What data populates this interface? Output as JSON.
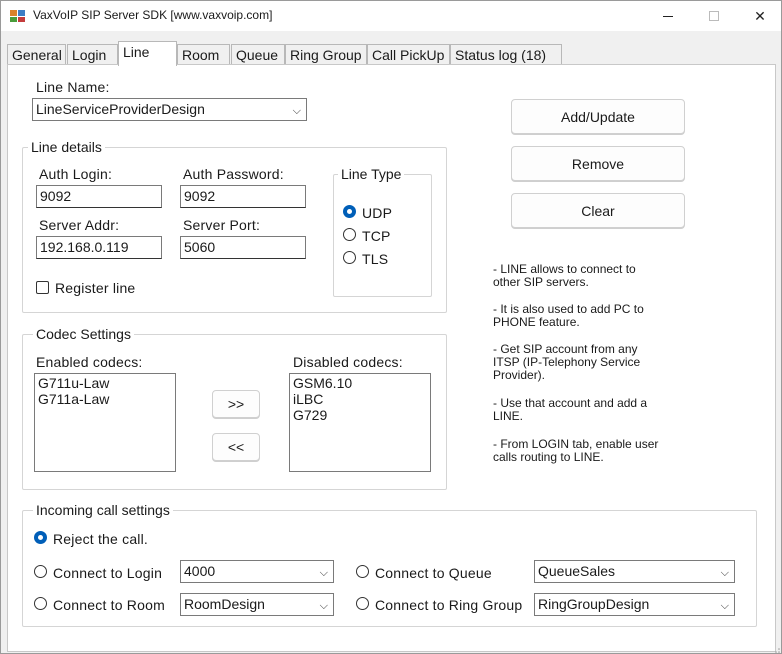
{
  "window": {
    "title": "VaxVoIP SIP Server SDK [www.vaxvoip.com]",
    "controls": {
      "minimize": "minimize",
      "maximize": "maximize",
      "close": "✕"
    }
  },
  "tabs": [
    {
      "label": "General"
    },
    {
      "label": "Login"
    },
    {
      "label": "Line"
    },
    {
      "label": "Room"
    },
    {
      "label": "Queue"
    },
    {
      "label": "Ring Group"
    },
    {
      "label": "Call PickUp"
    },
    {
      "label": "Status log (18)"
    }
  ],
  "line_name": {
    "label": "Line Name:",
    "value": "LineServiceProviderDesign"
  },
  "buttons": {
    "add_update": "Add/Update",
    "remove": "Remove",
    "clear": "Clear",
    "move_right": ">>",
    "move_left": "<<"
  },
  "line_details": {
    "title": "Line details",
    "auth_login": {
      "label": "Auth Login:",
      "value": "9092"
    },
    "auth_password": {
      "label": "Auth Password:",
      "value": "9092"
    },
    "server_addr": {
      "label": "Server Addr:",
      "value": "192.168.0.119"
    },
    "server_port": {
      "label": "Server Port:",
      "value": "5060"
    },
    "register_line": {
      "label": "Register line",
      "checked": false
    },
    "line_type": {
      "title": "Line Type",
      "options": [
        {
          "label": "UDP",
          "checked": true
        },
        {
          "label": "TCP",
          "checked": false
        },
        {
          "label": "TLS",
          "checked": false
        }
      ]
    }
  },
  "info_text": [
    "- LINE allows to connect to",
    "other SIP servers.",
    "",
    "- It is also used to add PC to",
    "PHONE feature.",
    "",
    "- Get SIP account from any",
    "ITSP (IP-Telephony Service",
    "Provider).",
    "",
    "- Use that account and add a",
    "LINE.",
    "",
    "- From LOGIN tab, enable user",
    "calls routing to LINE."
  ],
  "codec_settings": {
    "title": "Codec Settings",
    "enabled_label": "Enabled codecs:",
    "disabled_label": "Disabled codecs:",
    "enabled": [
      "G711u-Law",
      "G711a-Law"
    ],
    "disabled": [
      "GSM6.10",
      "iLBC",
      "G729"
    ]
  },
  "incoming": {
    "title": "Incoming call settings",
    "reject": {
      "label": "Reject the call.",
      "checked": true
    },
    "login": {
      "label": "Connect to Login",
      "value": "4000",
      "checked": false
    },
    "room": {
      "label": "Connect to Room",
      "value": "RoomDesign",
      "checked": false
    },
    "queue": {
      "label": "Connect to Queue",
      "value": "QueueSales",
      "checked": false
    },
    "ring_group": {
      "label": "Connect to Ring Group",
      "value": "RingGroupDesign",
      "checked": false
    }
  },
  "colors": {
    "accent": "#005fb8",
    "window_bg": "#f0f0f0",
    "page_bg": "#ffffff"
  }
}
